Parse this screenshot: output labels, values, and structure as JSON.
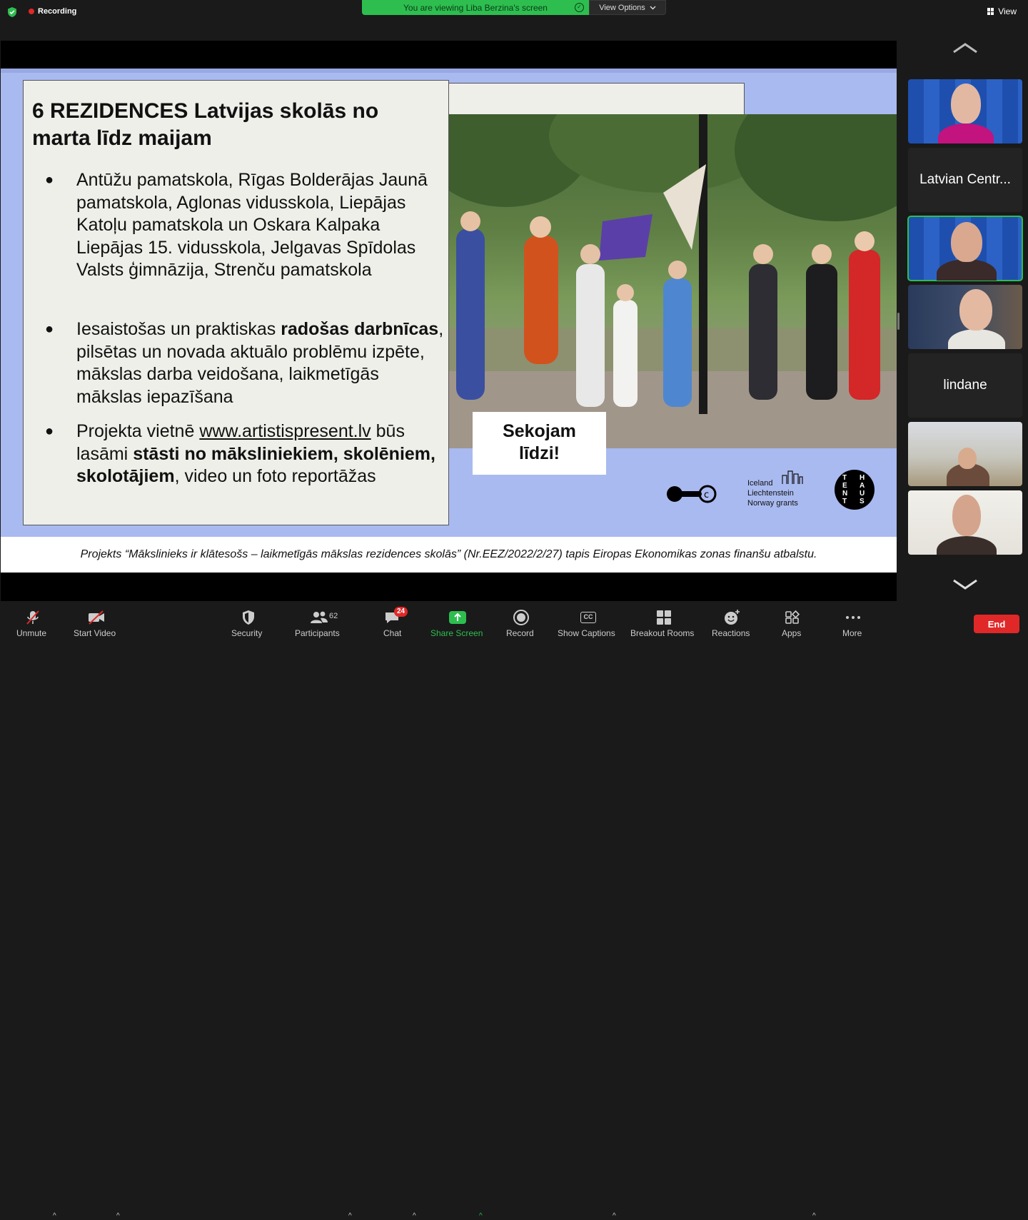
{
  "top_bar": {
    "recording_label": "Recording",
    "viewing_banner": "You are viewing Liba Berzina's screen",
    "view_options_label": "View Options",
    "view_label": "View"
  },
  "slide": {
    "title_line1": "6 REZIDENCES Latvijas skolās no",
    "title_line2": "marta līdz maijam",
    "bullet1": "Antūžu pamatskola, Rīgas Bolderājas Jaunā pamatskola, Aglonas vidusskola, Liepājas Katoļu pamatskola un Oskara Kalpaka Liepājas 15. vidusskola, Jelgavas Spīdolas Valsts ģimnāzija, Strenču pamatskola",
    "bullet2_a": "Iesaistošas un praktiskas ",
    "bullet2_b": "radošas darbnīcas",
    "bullet2_c": ", pilsētas un novada aktuālo problēmu izpēte, mākslas darba veidošana, laikmetīgās mākslas iepazīšana",
    "bullet3_a": "Projekta vietnē ",
    "bullet3_link": "www.artistispresent.lv",
    "bullet3_b": " būs lasāmi ",
    "bullet3_c": "stāsti no māksliniekiem, skolēniem, skolotājiem",
    "bullet3_d": ", video un foto reportāžas",
    "photo_caption_line1": "Sekojam",
    "photo_caption_line2": "līdzi!",
    "grants_line1": "Iceland",
    "grants_line2": "Liechtenstein",
    "grants_line3": "Norway",
    "grants_line3b": " grants",
    "tent_letters_left": "TENT",
    "tent_letters_right": "HAUS",
    "footer": "Projekts “Mākslinieks ir klātesošs – laikmetīgās mākslas rezidences skolās” (Nr.EEZ/2022/2/27) tapis Eiropas Ekonomikas zonas finanšu atbalstu."
  },
  "gallery": {
    "tile2_name": "Latvian Centr...",
    "tile5_name": "lindane"
  },
  "toolbar": {
    "unmute": "Unmute",
    "start_video": "Start Video",
    "security": "Security",
    "participants": "Participants",
    "participants_count": "62",
    "chat": "Chat",
    "chat_badge": "24",
    "share_screen": "Share Screen",
    "record": "Record",
    "show_captions": "Show Captions",
    "captions_icon_text": "CC",
    "breakout_rooms": "Breakout Rooms",
    "reactions": "Reactions",
    "apps": "Apps",
    "more": "More",
    "end": "End"
  },
  "colors": {
    "accent_green": "#2dbe4f",
    "end_red": "#e02828",
    "slide_bg": "#a9baf0"
  }
}
